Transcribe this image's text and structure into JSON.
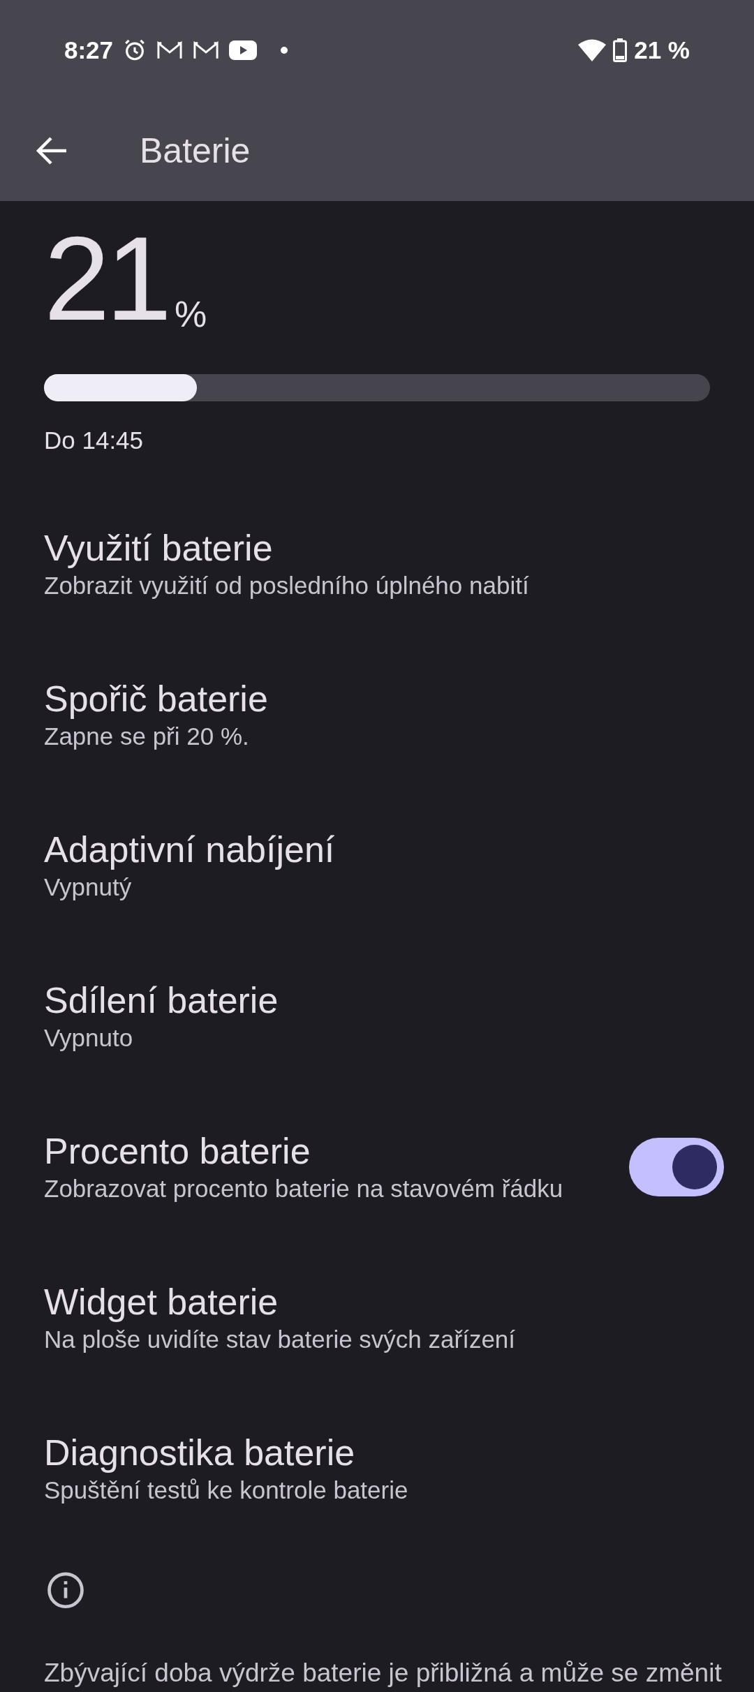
{
  "status_bar": {
    "time": "8:27",
    "battery_text": "21 %"
  },
  "app_bar": {
    "title": "Baterie"
  },
  "battery": {
    "percent": "21",
    "unit": "%",
    "level": 0.23,
    "estimate": "Do 14:45"
  },
  "settings": [
    {
      "kind": "item",
      "title": "Využití baterie",
      "subtitle": "Zobrazit využití od posledního úplného nabití"
    },
    {
      "kind": "item",
      "title": "Spořič baterie",
      "subtitle": "Zapne se při 20 %."
    },
    {
      "kind": "item",
      "title": "Adaptivní nabíjení",
      "subtitle": "Vypnutý"
    },
    {
      "kind": "item",
      "title": "Sdílení baterie",
      "subtitle": "Vypnuto"
    },
    {
      "kind": "toggle",
      "title": "Procento baterie",
      "subtitle": "Zobrazovat procento baterie na stavovém řádku",
      "on": true
    },
    {
      "kind": "item",
      "title": "Widget baterie",
      "subtitle": "Na ploše uvidíte stav baterie svých zařízení"
    },
    {
      "kind": "item",
      "title": "Diagnostika baterie",
      "subtitle": "Spuštění testů ke kontrole baterie"
    }
  ],
  "footer": {
    "text": "Zbývající doba výdrže baterie je přibližná a může se změnit"
  }
}
